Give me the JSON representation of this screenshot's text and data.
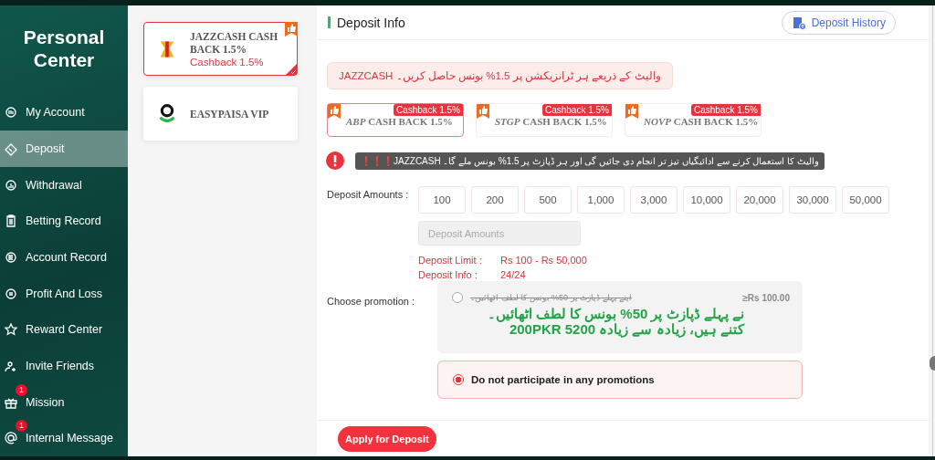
{
  "sidebar": {
    "title": "Personal Center",
    "items": [
      {
        "label": "My Account",
        "selected": false
      },
      {
        "label": "Deposit",
        "selected": true
      },
      {
        "label": "Withdrawal",
        "selected": false
      },
      {
        "label": "Betting Record",
        "selected": false
      },
      {
        "label": "Account Record",
        "selected": false
      },
      {
        "label": "Profit And Loss",
        "selected": false
      },
      {
        "label": "Reward Center",
        "selected": false
      },
      {
        "label": "Invite Friends",
        "selected": false
      },
      {
        "label": "Mission",
        "selected": false,
        "badge": "1"
      },
      {
        "label": "Internal Message",
        "selected": false,
        "badge": "1"
      }
    ]
  },
  "channels": [
    {
      "name": "JAZZCASH CASH BACK 1.5%",
      "cashback": "Cashback 1.5%",
      "promoted": true,
      "selected": true
    },
    {
      "name": "EASYPAISA VIP",
      "promoted": false,
      "selected": false
    }
  ],
  "panel": {
    "title": "Deposit Info",
    "history_button": "Deposit History",
    "banner": "JAZZCASH والیٹ کے ذریعے ہر ٹرانزیکشن پر 1.5% بونس حاصل کریں۔",
    "sub_channels": [
      {
        "prefix": "ABP",
        "name": "CASH BACK 1.5%",
        "tag": "Cashback 1.5%",
        "selected": true
      },
      {
        "prefix": "STGP",
        "name": "CASH BACK 1.5%",
        "tag": "Cashback 1.5%",
        "selected": false
      },
      {
        "prefix": "NOVP",
        "name": "CASH BACK 1.5%",
        "tag": "Cashback 1.5%",
        "selected": false
      }
    ],
    "notice": "❗❗❗JAZZCASH والیٹ کا استعمال کرنے سے ادائیگیاں تیز تر انجام دی جائیں گی اور ہر ڈپازٹ پر 1.5% بونس ملے گا۔",
    "amounts_label": "Deposit Amounts :",
    "amounts": [
      "100",
      "200",
      "500",
      "1,000",
      "3,000",
      "10,000",
      "20,000",
      "30,000",
      "50,000"
    ],
    "amount_placeholder": "Deposit Amounts",
    "limits": [
      {
        "label": "Deposit Limit :",
        "value": "Rs  100  -  Rs  50,000"
      },
      {
        "label": "Deposit Info :",
        "value": "24/24"
      }
    ],
    "promotion_label": "Choose promotion :",
    "promotions": [
      {
        "kind": "offer",
        "caption": "اپنے پہلے ڈپازٹ پر 50% بونس کا لطف اٹھائیں۔",
        "minimum": "≥Rs  100.00",
        "headline": "نے پہلے ڈپازٹ پر 50% بونس کا لطف اٹھائیں۔ کتنے ہیں، زیادہ سے زیادہ 5200 200PKR",
        "selected": false,
        "disabled": true
      },
      {
        "kind": "none",
        "label": "Do not participate in any promotions",
        "selected": true,
        "disabled": false
      }
    ],
    "apply_button": "Apply for Deposit"
  }
}
